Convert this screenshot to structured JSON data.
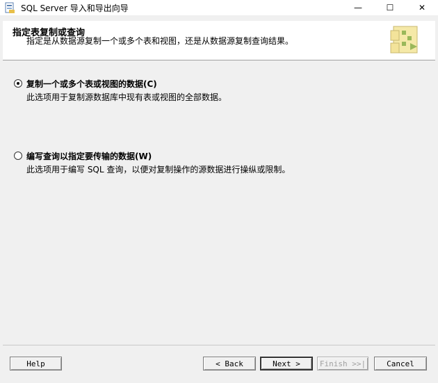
{
  "window": {
    "title": "SQL Server 导入和导出向导",
    "controls": {
      "minimize": "—",
      "maximize": "☐",
      "close": "✕"
    }
  },
  "header": {
    "title": "指定表复制或查询",
    "subtitle": "指定是从数据源复制一个或多个表和视图，还是从数据源复制查询结果。"
  },
  "options": [
    {
      "label": "复制一个或多个表或视图的数据(C)",
      "description": "此选项用于复制源数据库中现有表或视图的全部数据。",
      "selected": true
    },
    {
      "label": "编写查询以指定要传输的数据(W)",
      "description": "此选项用于编写 SQL 查询，以便对复制操作的源数据进行操纵或限制。",
      "selected": false
    }
  ],
  "buttons": {
    "help": "Help",
    "back": "< Back",
    "next": "Next >",
    "finish": "Finish >>|",
    "cancel": "Cancel"
  },
  "colors": {
    "window_bg": "#f0f0f0",
    "header_bg": "#ffffff",
    "logo_yellow": "#f5e9a8",
    "logo_green": "#9ab85a"
  }
}
